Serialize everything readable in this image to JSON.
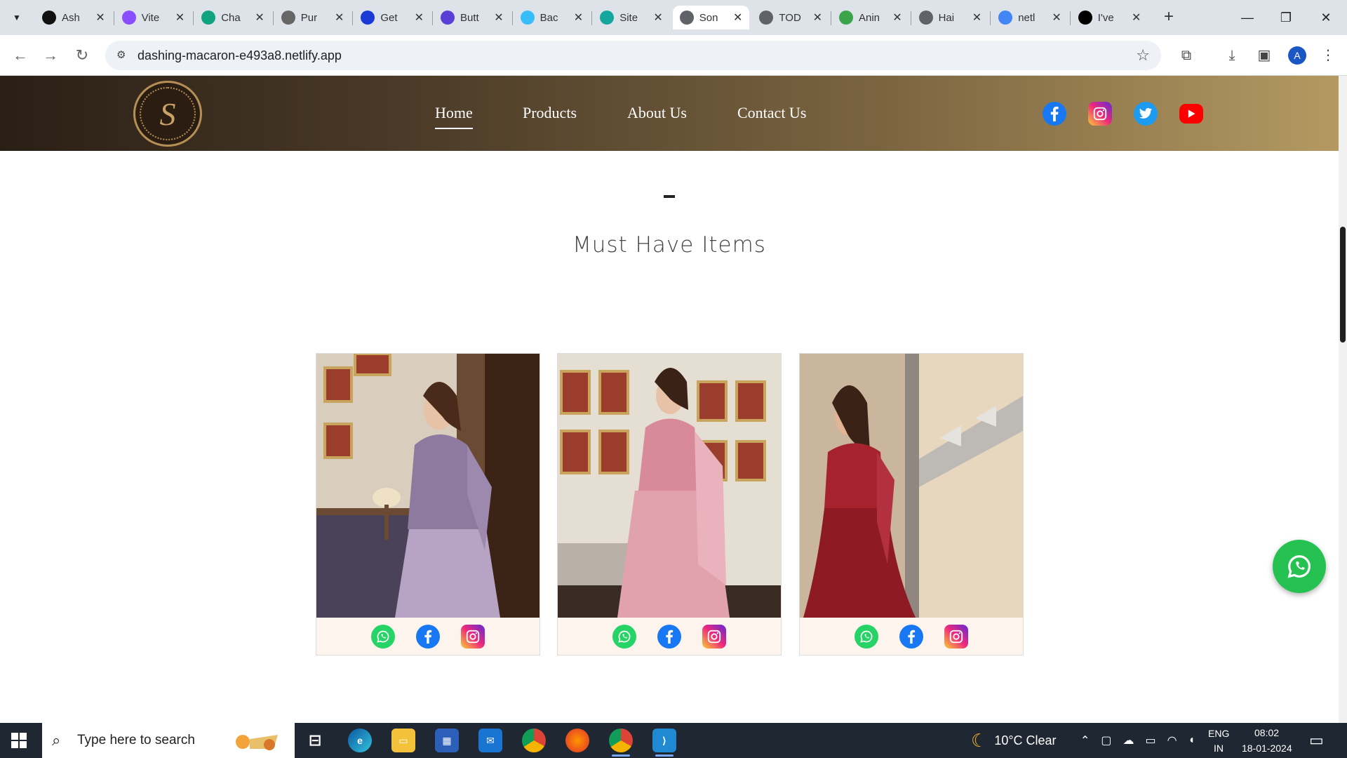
{
  "browser": {
    "tabs": [
      {
        "title": "Ash",
        "favicon": "github-icon",
        "color": "#111111"
      },
      {
        "title": "Vite",
        "favicon": "vite-icon",
        "color": "#8a4dff"
      },
      {
        "title": "Cha",
        "favicon": "chatgpt-icon",
        "color": "#10a37f"
      },
      {
        "title": "Pur",
        "favicon": "framer-icon",
        "color": "#666666"
      },
      {
        "title": "Get",
        "favicon": "get-icon",
        "color": "#1a3bd6"
      },
      {
        "title": "Butt",
        "favicon": "uiverse-icon",
        "color": "#5a3fd6"
      },
      {
        "title": "Bac",
        "favicon": "tailwind-icon",
        "color": "#38bdf8"
      },
      {
        "title": "Site",
        "favicon": "netlify-icon",
        "color": "#15a79e"
      },
      {
        "title": "Son",
        "favicon": "globe-icon",
        "color": "#5f6368",
        "active": true
      },
      {
        "title": "TOD",
        "favicon": "clipboard-icon",
        "color": "#5f6368"
      },
      {
        "title": "Anin",
        "favicon": "animation-icon",
        "color": "#3aa44a"
      },
      {
        "title": "Hai",
        "favicon": "globe-icon",
        "color": "#5f6368"
      },
      {
        "title": "netl",
        "favicon": "google-icon",
        "color": "#4285f4"
      },
      {
        "title": "I've",
        "favicon": "dev-icon",
        "color": "#000000"
      }
    ],
    "url": "dashing-macaron-e493a8.netlify.app",
    "profile_initial": "A"
  },
  "site": {
    "logo_letter": "S",
    "nav": [
      "Home",
      "Products",
      "About Us",
      "Contact Us"
    ],
    "active_nav": "Home",
    "section_title": "Must Have Items",
    "products": [
      {
        "name": "lavender-outfit",
        "color": "#9e85a8"
      },
      {
        "name": "pink-lehenga",
        "color": "#d9a0a8"
      },
      {
        "name": "red-saree",
        "color": "#a4222c"
      }
    ]
  },
  "taskbar": {
    "search_placeholder": "Type here to search",
    "weather": "10°C  Clear",
    "lang_top": "ENG",
    "lang_bottom": "IN",
    "time": "08:02",
    "date": "18-01-2024"
  }
}
